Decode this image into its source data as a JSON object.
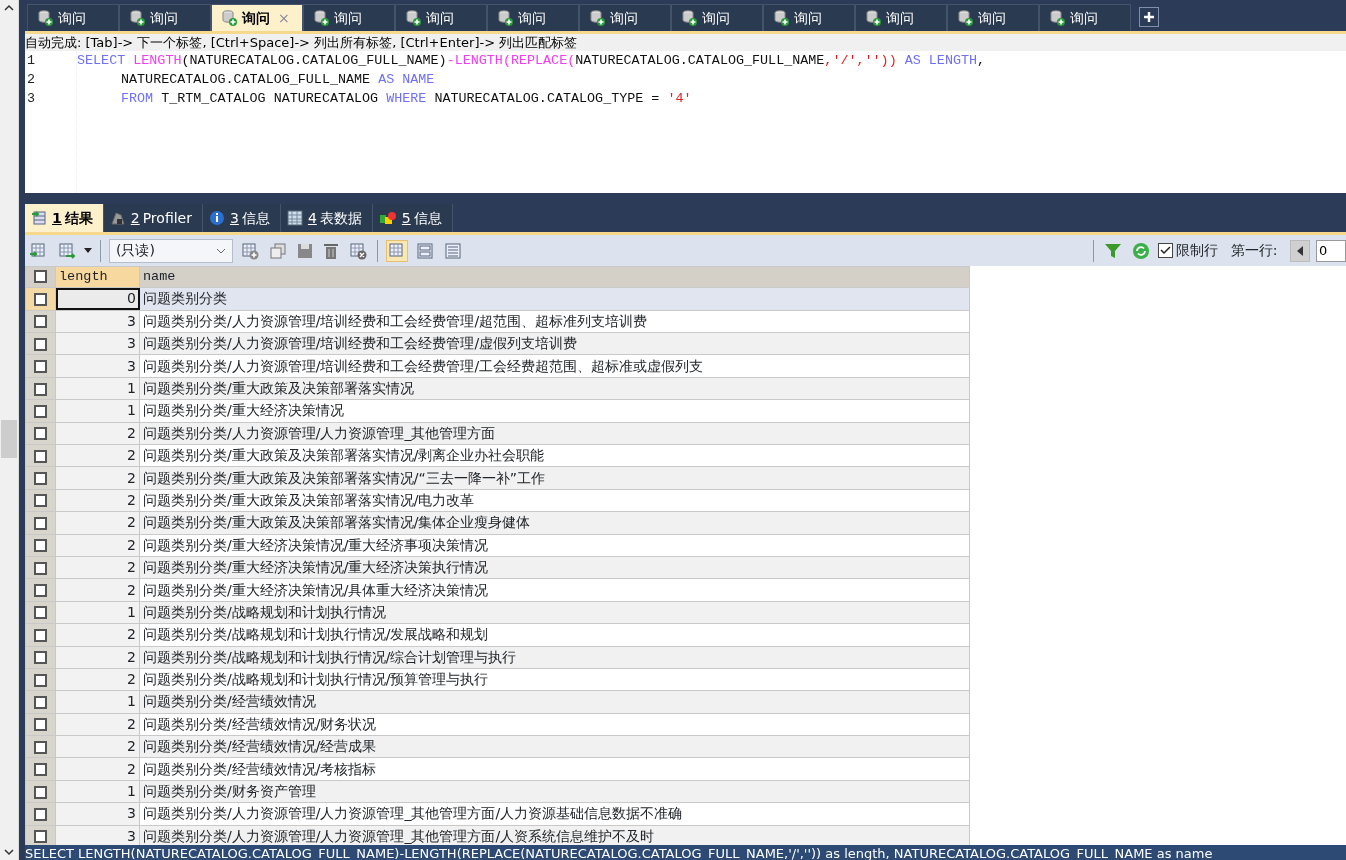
{
  "query_tabs": [
    {
      "label": "询问",
      "selected": false
    },
    {
      "label": "询问",
      "selected": false
    },
    {
      "label": "询问",
      "selected": true,
      "closable": true,
      "close": "×"
    },
    {
      "label": "询问",
      "selected": false
    },
    {
      "label": "询问",
      "selected": false
    },
    {
      "label": "询问",
      "selected": false
    },
    {
      "label": "询问",
      "selected": false
    },
    {
      "label": "询问",
      "selected": false
    },
    {
      "label": "询问",
      "selected": false
    },
    {
      "label": "询问",
      "selected": false
    },
    {
      "label": "询问",
      "selected": false
    },
    {
      "label": "询问",
      "selected": false
    }
  ],
  "autocomplete_hint": "自动完成: [Tab]-> 下一个标签, [Ctrl+Space]-> 列出所有标签, [Ctrl+Enter]-> 列出匹配标签",
  "editor": {
    "lines": [
      {
        "number": "1",
        "indent": false,
        "tokens": [
          {
            "kind": "keyword",
            "text": "SELECT "
          },
          {
            "kind": "function",
            "text": "LENGTH"
          },
          {
            "kind": "plain",
            "text": "(NATURECATALOG.CATALOG_FULL_NAME)"
          },
          {
            "kind": "function",
            "text": "-LENGTH(REPLACE("
          },
          {
            "kind": "plain",
            "text": "NATURECATALOG.CATALOG_FULL_NAME"
          },
          {
            "kind": "string",
            "text": ",'/',''))"
          },
          {
            "kind": "keyword",
            "text": " AS LENGTH"
          },
          {
            "kind": "plain",
            "text": ","
          }
        ]
      },
      {
        "number": "2",
        "indent": true,
        "tokens": [
          {
            "kind": "plain",
            "text": "NATURECATALOG.CATALOG_FULL_NAME "
          },
          {
            "kind": "keyword",
            "text": "AS NAME"
          }
        ]
      },
      {
        "number": "3",
        "indent": true,
        "tokens": [
          {
            "kind": "keyword",
            "text": "FROM "
          },
          {
            "kind": "plain",
            "text": "T_RTM_CATALOG NATURECATALOG "
          },
          {
            "kind": "keyword",
            "text": "WHERE "
          },
          {
            "kind": "plain",
            "text": "NATURECATALOG.CATALOG_TYPE = "
          },
          {
            "kind": "string",
            "text": "'4'"
          }
        ]
      }
    ]
  },
  "result_tabs": [
    {
      "number": "1",
      "label": "结果",
      "selected": true
    },
    {
      "number": "2",
      "label": "Profiler",
      "selected": false
    },
    {
      "number": "3",
      "label": "信息",
      "selected": false
    },
    {
      "number": "4",
      "label": "表数据",
      "selected": false
    },
    {
      "number": "5",
      "label": "信息",
      "selected": false
    }
  ],
  "toolbar": {
    "mode_select": "(只读)",
    "limit_rows": {
      "label": "限制行",
      "checked": true
    },
    "first_row_label": "第一行:",
    "first_row_value": "0"
  },
  "table": {
    "select_all_checked": false,
    "columns": [
      "length",
      "name"
    ],
    "rows": [
      {
        "checked": false,
        "selected": true,
        "length": "0",
        "name": "问题类别分类"
      },
      {
        "checked": false,
        "selected": false,
        "length": "3",
        "name": "问题类别分类/人力资源管理/培训经费和工会经费管理/超范围、超标准列支培训费"
      },
      {
        "checked": false,
        "selected": false,
        "length": "3",
        "name": "问题类别分类/人力资源管理/培训经费和工会经费管理/虚假列支培训费"
      },
      {
        "checked": false,
        "selected": false,
        "length": "3",
        "name": "问题类别分类/人力资源管理/培训经费和工会经费管理/工会经费超范围、超标准或虚假列支"
      },
      {
        "checked": false,
        "selected": false,
        "length": "1",
        "name": "问题类别分类/重大政策及决策部署落实情况"
      },
      {
        "checked": false,
        "selected": false,
        "length": "1",
        "name": "问题类别分类/重大经济决策情况"
      },
      {
        "checked": false,
        "selected": false,
        "length": "2",
        "name": "问题类别分类/人力资源管理/人力资源管理_其他管理方面"
      },
      {
        "checked": false,
        "selected": false,
        "length": "2",
        "name": "问题类别分类/重大政策及决策部署落实情况/剥离企业办社会职能"
      },
      {
        "checked": false,
        "selected": false,
        "length": "2",
        "name": "问题类别分类/重大政策及决策部署落实情况/“三去一降一补”工作"
      },
      {
        "checked": false,
        "selected": false,
        "length": "2",
        "name": "问题类别分类/重大政策及决策部署落实情况/电力改革"
      },
      {
        "checked": false,
        "selected": false,
        "length": "2",
        "name": "问题类别分类/重大政策及决策部署落实情况/集体企业瘦身健体"
      },
      {
        "checked": false,
        "selected": false,
        "length": "2",
        "name": "问题类别分类/重大经济决策情况/重大经济事项决策情况"
      },
      {
        "checked": false,
        "selected": false,
        "length": "2",
        "name": "问题类别分类/重大经济决策情况/重大经济决策执行情况"
      },
      {
        "checked": false,
        "selected": false,
        "length": "2",
        "name": "问题类别分类/重大经济决策情况/具体重大经济决策情况"
      },
      {
        "checked": false,
        "selected": false,
        "length": "1",
        "name": "问题类别分类/战略规划和计划执行情况"
      },
      {
        "checked": false,
        "selected": false,
        "length": "2",
        "name": "问题类别分类/战略规划和计划执行情况/发展战略和规划"
      },
      {
        "checked": false,
        "selected": false,
        "length": "2",
        "name": "问题类别分类/战略规划和计划执行情况/综合计划管理与执行"
      },
      {
        "checked": false,
        "selected": false,
        "length": "2",
        "name": "问题类别分类/战略规划和计划执行情况/预算管理与执行"
      },
      {
        "checked": false,
        "selected": false,
        "length": "1",
        "name": "问题类别分类/经营绩效情况"
      },
      {
        "checked": false,
        "selected": false,
        "length": "2",
        "name": "问题类别分类/经营绩效情况/财务状况"
      },
      {
        "checked": false,
        "selected": false,
        "length": "2",
        "name": "问题类别分类/经营绩效情况/经营成果"
      },
      {
        "checked": false,
        "selected": false,
        "length": "2",
        "name": "问题类别分类/经营绩效情况/考核指标"
      },
      {
        "checked": false,
        "selected": false,
        "length": "1",
        "name": "问题类别分类/财务资产管理"
      },
      {
        "checked": false,
        "selected": false,
        "length": "3",
        "name": "问题类别分类/人力资源管理/人力资源管理_其他管理方面/人力资源基础信息数据不准确"
      },
      {
        "checked": false,
        "selected": false,
        "length": "3",
        "name": "问题类别分类/人力资源管理/人力资源管理_其他管理方面/人资系统信息维护不及时"
      }
    ]
  },
  "status_bar": "SELECT LENGTH(NATURECATALOG.CATALOG_FULL_NAME)-LENGTH(REPLACE(NATURECATALOG.CATALOG_FULL_NAME,'/','')) as length, NATURECATALOG.CATALOG_FULL_NAME as name"
}
